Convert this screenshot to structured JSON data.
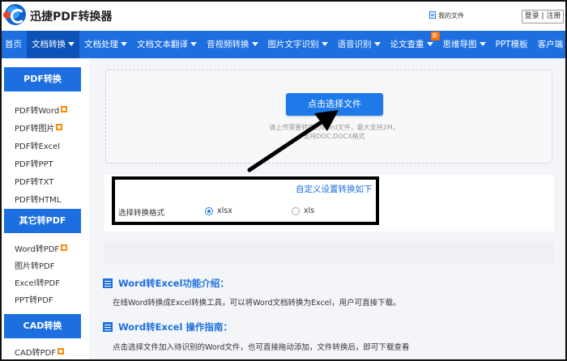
{
  "header": {
    "brand": "迅捷PDF转换器",
    "my_files": "我的文件",
    "login": "登录",
    "separator": "|",
    "register": "注册"
  },
  "nav": {
    "items": [
      {
        "label": "首页",
        "caret": false
      },
      {
        "label": "文档转换",
        "caret": true,
        "active": true
      },
      {
        "label": "文档处理",
        "caret": true
      },
      {
        "label": "文档文本翻译",
        "caret": true
      },
      {
        "label": "音视频转换",
        "caret": true
      },
      {
        "label": "图片文字识别",
        "caret": true
      },
      {
        "label": "语音识别",
        "caret": true
      },
      {
        "label": "论文查重",
        "caret": true,
        "badge": "新"
      },
      {
        "label": "思维导图",
        "caret": true
      },
      {
        "label": "PPT模板",
        "caret": false
      },
      {
        "label": "客户端",
        "caret": true
      }
    ]
  },
  "sidebar": {
    "groups": [
      {
        "title": "PDF转换",
        "items": [
          "PDF转Word",
          "PDF转图片",
          "PDF转Excel",
          "PDF转PPT",
          "PDF转TXT",
          "PDF转HTML"
        ]
      },
      {
        "title": "其它转PDF",
        "items": [
          "Word转PDF",
          "图片转PDF",
          "Excel转PDF",
          "PPT转PDF"
        ]
      },
      {
        "title": "CAD转换",
        "items": [
          "CAD转PDF"
        ]
      }
    ]
  },
  "upload": {
    "button": "点击选择文件",
    "hint_line1": "请上传需要转换的Word文件，最大支持2M，",
    "hint_line2": "支持DOC,DOCX格式"
  },
  "settings": {
    "custom_link": "自定义设置转换如下",
    "format_label": "选择转换格式",
    "options": [
      {
        "label": "xlsx",
        "checked": true
      },
      {
        "label": "xls",
        "checked": false
      }
    ]
  },
  "intro": {
    "title": "Word转Excel功能介绍：",
    "text": "在线Word转换成Excel转换工具，可以将Word文档转换为Excel，用户可直接下载。"
  },
  "guide": {
    "title": "Word转Excel 操作指南：",
    "text": "点击选择文件加入待识别的Word文件，也可直接拖动添加，文件转换后，即可下载查看"
  },
  "colors": {
    "primary": "#1d6fe0",
    "active_nav": "#0e52b8",
    "badge": "#ff6a00",
    "upload_button": "#1e7ae8"
  }
}
